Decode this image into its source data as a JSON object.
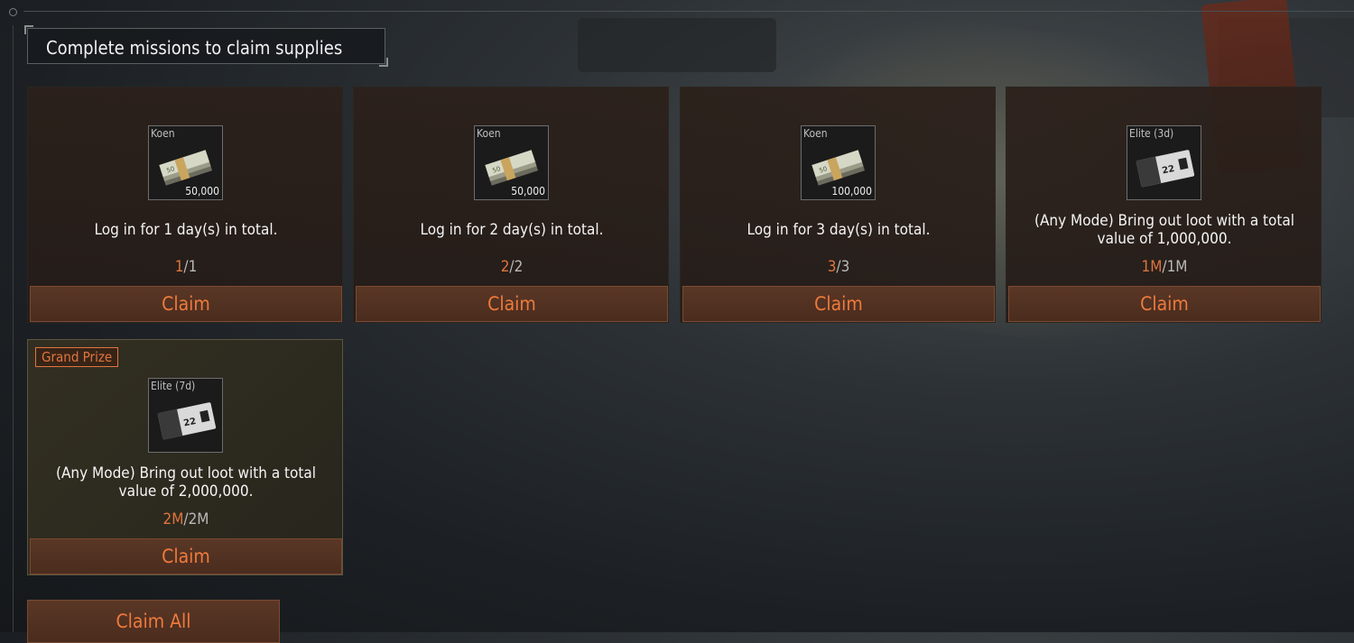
{
  "header": {
    "title": "Complete missions to claim supplies"
  },
  "missions": [
    {
      "item_type": "Koen",
      "item_qty": "50,000",
      "item_icon": "cash-stack-icon",
      "task": "Log in for 1 day(s) in total.",
      "progress_current": "1",
      "progress_total": "/1",
      "claim_label": "Claim"
    },
    {
      "item_type": "Koen",
      "item_qty": "50,000",
      "item_icon": "cash-stack-icon",
      "task": "Log in for 2 day(s) in total.",
      "progress_current": "2",
      "progress_total": "/2",
      "claim_label": "Claim"
    },
    {
      "item_type": "Koen",
      "item_qty": "100,000",
      "item_icon": "cash-stack-icon",
      "task": "Log in for 3 day(s) in total.",
      "progress_current": "3",
      "progress_total": "/3",
      "claim_label": "Claim"
    },
    {
      "item_type": "Elite (3d)",
      "item_qty": "",
      "item_icon": "elite-card-icon",
      "task": "(Any Mode)  Bring out loot with a total value of 1,000,000.",
      "progress_current": "1M",
      "progress_total": "/1M",
      "claim_label": "Claim"
    }
  ],
  "grand_prize": {
    "badge": "Grand Prize",
    "item_type": "Elite (7d)",
    "item_icon": "elite-card-icon",
    "task": "(Any Mode)  Bring out loot with a total value of 2,000,000.",
    "progress_current": "2M",
    "progress_total": "/2M",
    "claim_label": "Claim"
  },
  "claim_all_label": "Claim All",
  "colors": {
    "accent": "#ee7a3c",
    "progress_done": "#e0753e",
    "button_bg": "#4a2c1e"
  }
}
